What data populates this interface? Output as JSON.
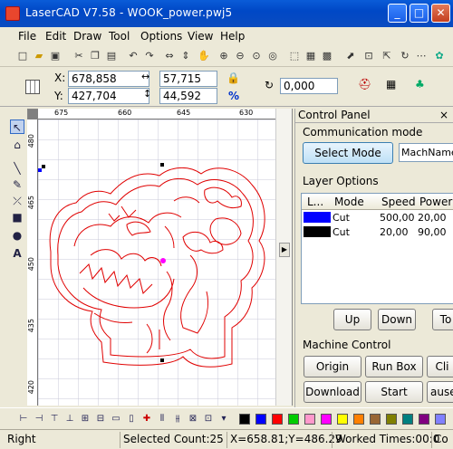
{
  "window": {
    "title": "LaserCAD V7.58 - WOOK_power.pwj5",
    "minimize": "_",
    "maximize": "□",
    "close": "✕"
  },
  "menu": [
    "File",
    "Edit",
    "Draw",
    "Tool",
    "Options",
    "View",
    "Help"
  ],
  "toolbar_icons": [
    "new-icon",
    "open-icon",
    "save-icon",
    "cut-icon",
    "copy-icon",
    "paste-icon",
    "undo-icon",
    "redo-icon",
    "hand-icon",
    "zoom-in-icon",
    "zoom-out-icon",
    "zoom-window-icon",
    "zoom-fit-icon",
    "select-all-icon",
    "group-icon",
    "ungroup-icon",
    "node-edit-icon",
    "break-icon",
    "weld-icon",
    "settings-icon",
    "tools-icon"
  ],
  "properties": {
    "x_label": "X:",
    "x_value": "678,858",
    "y_label": "Y:",
    "y_value": "427,704",
    "width_value": "57,715",
    "height_value": "44,592",
    "percent_symbol": "%",
    "rotate_value": "0,000"
  },
  "rulers": {
    "top": [
      "675",
      "660",
      "645",
      "630"
    ],
    "left": [
      "480",
      "465",
      "450",
      "435",
      "420"
    ]
  },
  "control_panel": {
    "title": "Control Panel",
    "close": "×",
    "communication_mode": "Communication mode",
    "select_mode_button": "Select Mode",
    "mach_name": "MachName",
    "layer_options": "Layer Options",
    "columns": [
      "L...",
      "Mode",
      "Speed",
      "Power"
    ],
    "layers": [
      {
        "color": "#0000ff",
        "mode": "Cut",
        "speed": "500,00",
        "power": "20,00"
      },
      {
        "color": "#000000",
        "mode": "Cut",
        "speed": "20,00",
        "power": "90,00"
      }
    ],
    "up_button": "Up",
    "down_button": "Down",
    "to_button": "To",
    "machine_control": "Machine Control",
    "origin_button": "Origin",
    "run_box_button": "Run Box",
    "clr_button": "Cli",
    "download_button": "Download",
    "start_button": "Start",
    "pause_button": "ause"
  },
  "palette": [
    "#000000",
    "#0000ff",
    "#ff0000",
    "#00ff00",
    "#ffff00",
    "#ff00ff",
    "#00ffff",
    "#ff8000",
    "#804000",
    "#808000",
    "#008080",
    "#800080",
    "#8080ff",
    "#404040"
  ],
  "status": {
    "mode": "Right",
    "selected": "Selected Count:25",
    "coords": "X=658.81;Y=486.29",
    "worked": "Worked Times:00:0",
    "co": "Co"
  }
}
